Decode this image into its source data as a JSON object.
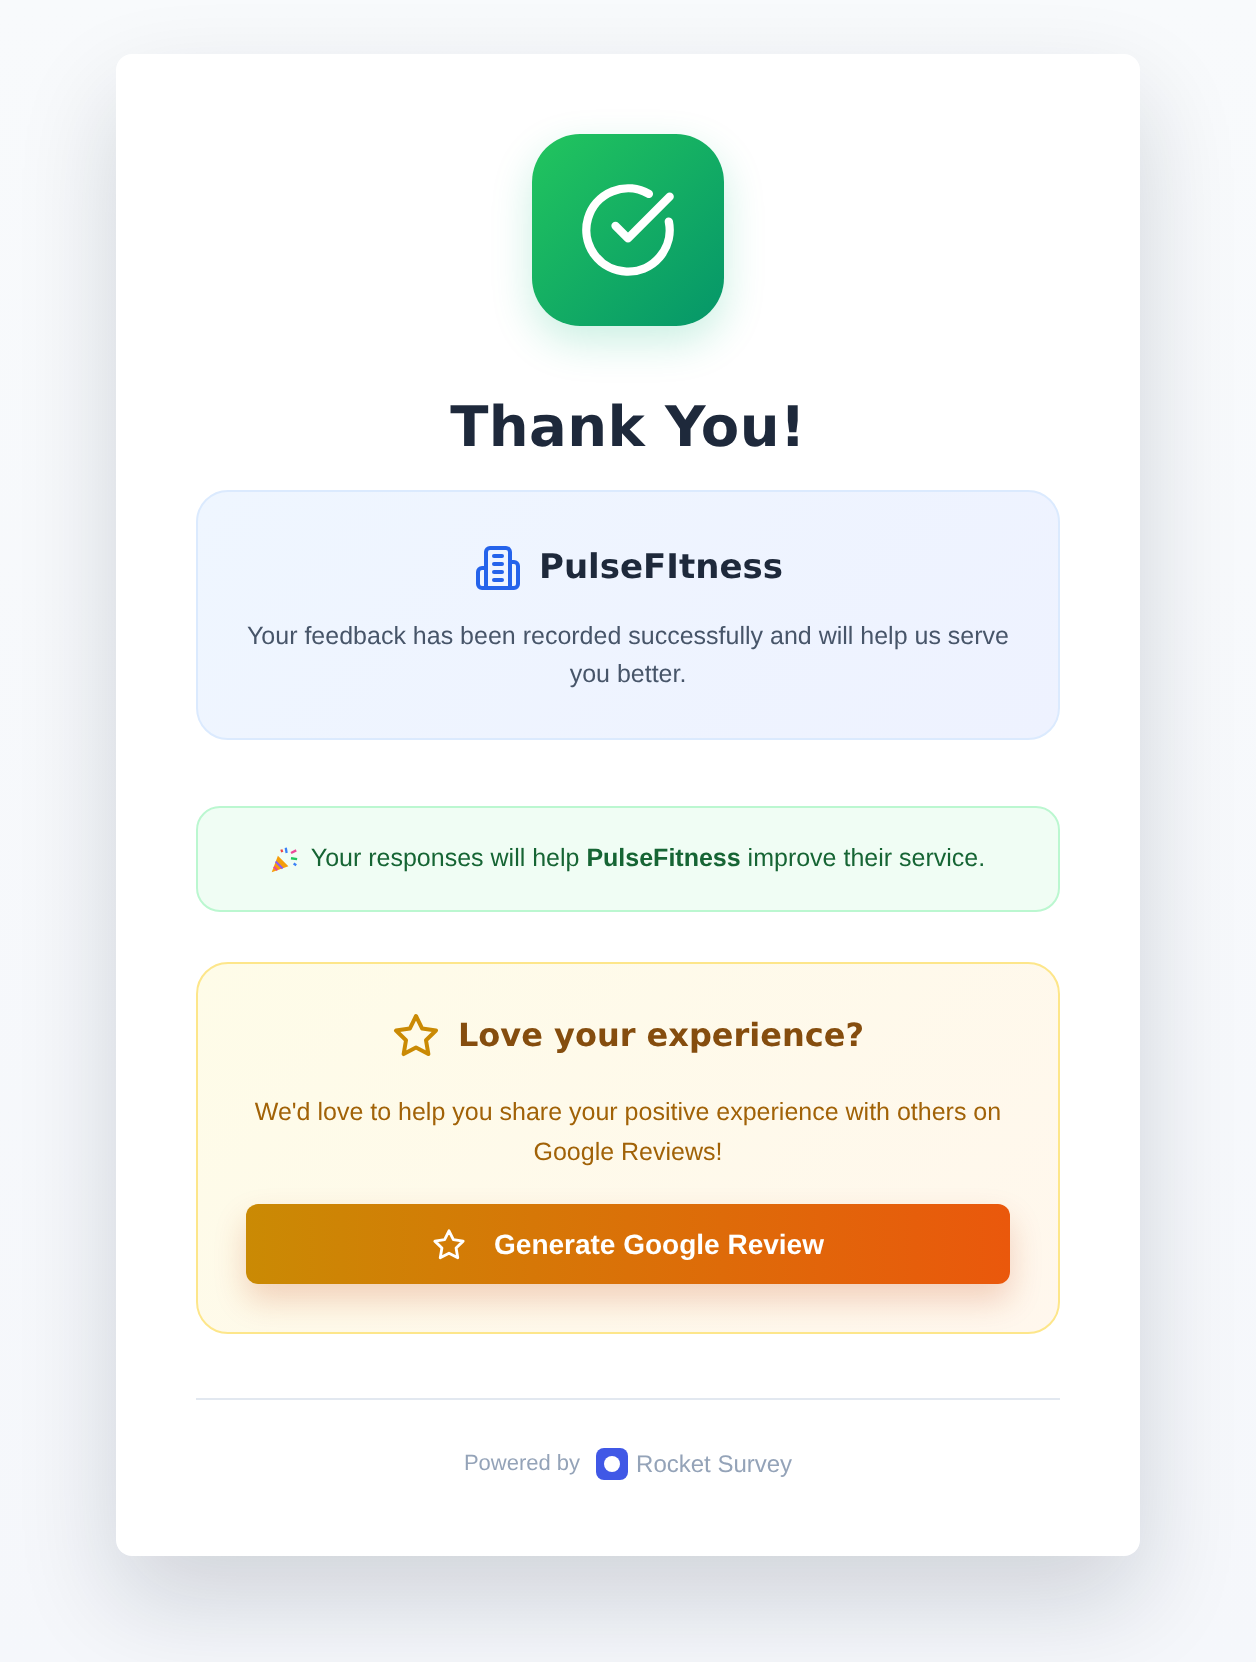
{
  "header": {
    "title": "Thank You!"
  },
  "business_card": {
    "name": "PulseFItness",
    "message": "Your feedback has been recorded successfully and will help us serve you better."
  },
  "notice": {
    "text": "Your responses will help **PulseFitness** improve their service."
  },
  "review_prompt": {
    "title": "Love your experience?",
    "message": "We'd love to help you share your positive experience with others on Google Reviews!",
    "button": "Generate Google Review"
  },
  "footer": {
    "powered_by": "Powered by",
    "brand": "Rocket Survey"
  }
}
